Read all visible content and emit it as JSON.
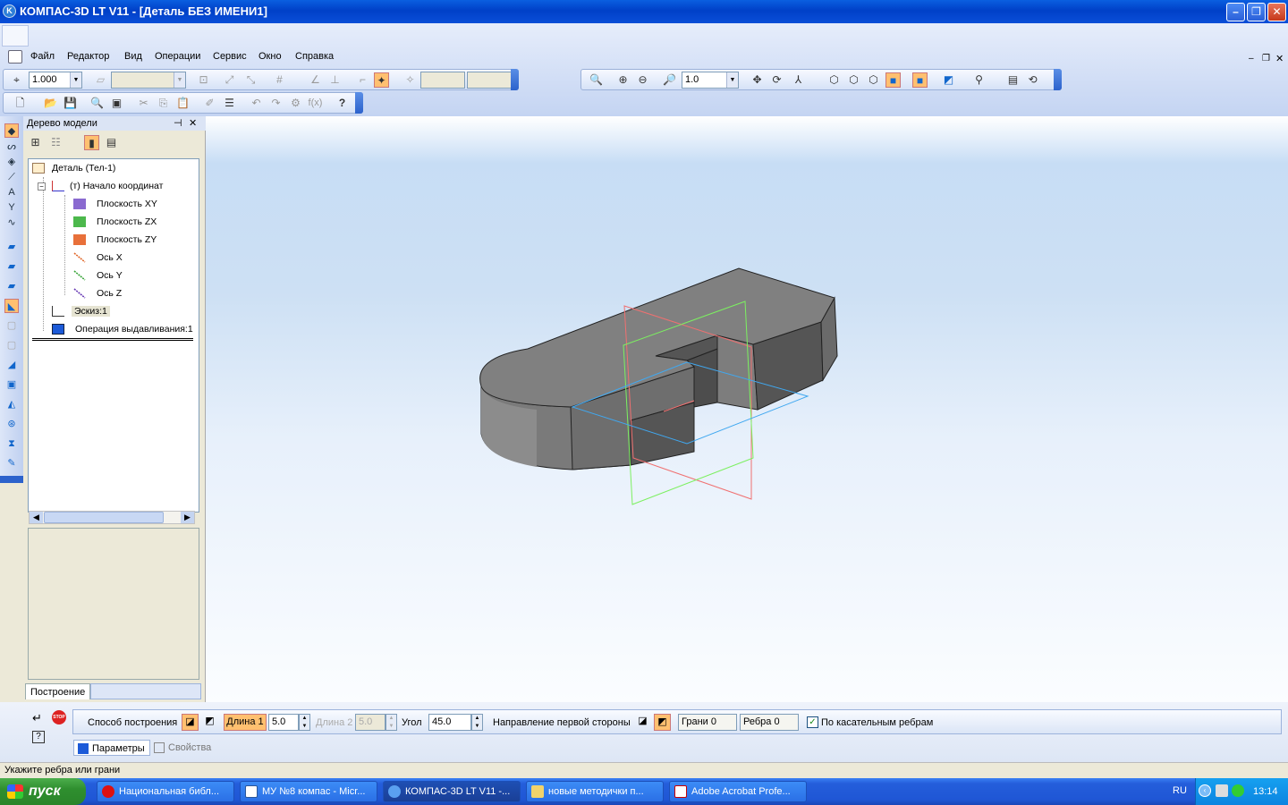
{
  "window": {
    "title": "КОМПАС-3D LT V11 - [Деталь БЕЗ ИМЕНИ1]",
    "icon": "kompas-logo-icon"
  },
  "menu": [
    "Файл",
    "Редактор",
    "Вид",
    "Операции",
    "Сервис",
    "Окно",
    "Справка"
  ],
  "toolbar_current": {
    "scale_value": "1.000"
  },
  "toolbar_view": {
    "zoom_value": "1.0"
  },
  "model_tree": {
    "title": "Дерево модели",
    "items": [
      {
        "label": "Деталь (Тел-1)",
        "icon": "part-icon"
      },
      {
        "label": "(т) Начало координат",
        "icon": "origin-icon"
      },
      {
        "label": "Плоскость XY",
        "icon": "plane-xy-icon"
      },
      {
        "label": "Плоскость ZX",
        "icon": "plane-zx-icon"
      },
      {
        "label": "Плоскость ZY",
        "icon": "plane-zy-icon"
      },
      {
        "label": "Ось X",
        "icon": "axis-x-icon"
      },
      {
        "label": "Ось Y",
        "icon": "axis-y-icon"
      },
      {
        "label": "Ось Z",
        "icon": "axis-z-icon"
      },
      {
        "label": "Эскиз:1",
        "icon": "sketch-icon"
      },
      {
        "label": "Операция выдавливания:1",
        "icon": "extrude-icon"
      }
    ],
    "tab": "Построение"
  },
  "property_bar": {
    "method_label": "Способ построения",
    "length1_label": "Длина 1",
    "length1_value": "5.0",
    "length2_label": "Длина 2",
    "length2_value": "5.0",
    "angle_label": "Угол",
    "angle_value": "45.0",
    "direction_label": "Направление первой стороны",
    "faces_label": "Грани 0",
    "edges_label": "Ребра 0",
    "tangent_label": "По касательным ребрам",
    "tangent_checked": true,
    "tabs": [
      "Параметры",
      "Свойства"
    ]
  },
  "status": {
    "text": "Укажите ребра или грани"
  },
  "taskbar": {
    "start_label": "пуск",
    "tasks": [
      {
        "label": "Национальная библ...",
        "icon": "opera-icon",
        "active": false
      },
      {
        "label": "МУ №8 компас - Micr...",
        "icon": "word-icon",
        "active": false
      },
      {
        "label": "КОМПАС-3D LT V11 -...",
        "icon": "kompas-icon",
        "active": true
      },
      {
        "label": "новые методички п...",
        "icon": "folder-icon",
        "active": false
      },
      {
        "label": "Adobe Acrobat Profe...",
        "icon": "acrobat-icon",
        "active": false
      }
    ],
    "lang": "RU",
    "clock": "13:14"
  }
}
